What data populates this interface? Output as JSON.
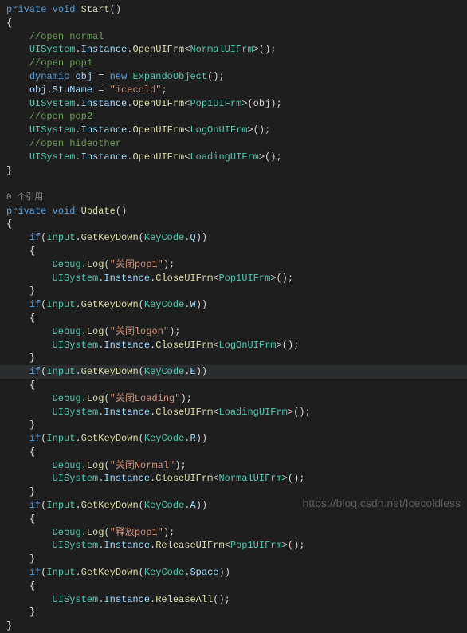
{
  "code": {
    "start_sig": {
      "priv": "private",
      "void": "void",
      "name": "Start",
      "parens": "()"
    },
    "comments": {
      "open_normal": "//open normal",
      "open_pop1": "//open pop1",
      "open_pop2": "//open pop2",
      "open_hideother": "//open hideother"
    },
    "uisys": {
      "cls": "UISystem",
      "dot": ".",
      "inst": "Instance",
      "open": "OpenUIFrm",
      "close": "CloseUIFrm",
      "release": "ReleaseUIFrm",
      "releaseAll": "ReleaseAll"
    },
    "types": {
      "normal": "NormalUIFrm",
      "pop1": "Pop1UIFrm",
      "logon": "LogOnUIFrm",
      "loading": "LoadingUIFrm",
      "expando": "ExpandoObject",
      "input": "Input",
      "keycode": "KeyCode",
      "debug": "Debug"
    },
    "dyn": {
      "dynamic": "dynamic",
      "obj": "obj",
      "eq": " = ",
      "new": "new",
      "end": "();"
    },
    "stu": {
      "obj": "obj",
      "dot": ".",
      "prop": "StuName",
      "eq": " = ",
      "val": "\"icecold\"",
      "semi": ";"
    },
    "ref_label": "0 个引用",
    "update_sig": {
      "priv": "private",
      "void": "void",
      "name": "Update",
      "parens": "()"
    },
    "kw": {
      "if": "if",
      "getkey": "GetKeyDown",
      "log": "Log"
    },
    "keys": {
      "q": "Q",
      "w": "W",
      "e": "E",
      "r": "R",
      "a": "A",
      "space": "Space"
    },
    "strings": {
      "close_pop1": "\"关闭pop1\"",
      "close_logon": "\"关闭logon\"",
      "close_loading": "\"关闭Loading\"",
      "close_normal": "\"关闭Normal\"",
      "release_pop1": "\"释放pop1\""
    },
    "sym": {
      "lt": "<",
      "gt": ">",
      "lp": "(",
      "rp": ")",
      "lb": "{",
      "rb": "}",
      "semi": ";",
      "dot": "."
    }
  },
  "watermark": "https://blog.csdn.net/Icecoldless"
}
